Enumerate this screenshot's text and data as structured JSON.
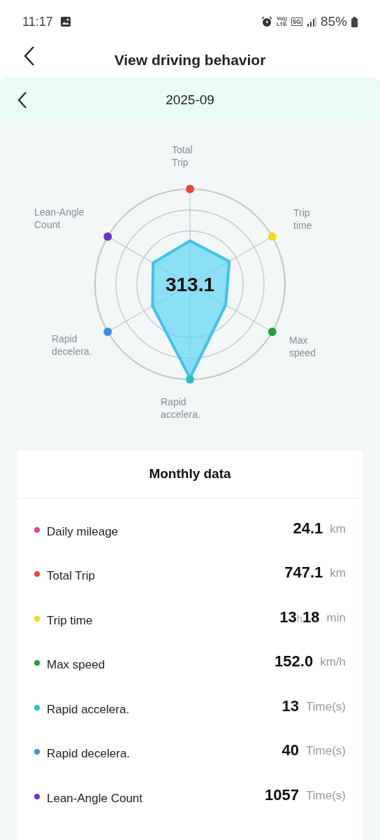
{
  "status_bar": {
    "time": "11:17",
    "volte": [
      "Vo))",
      "LTE"
    ],
    "network": "5G",
    "battery": "85%"
  },
  "header": {
    "title": "View driving behavior"
  },
  "month_bar": {
    "month": "2025-09"
  },
  "radar": {
    "score": "313.1",
    "axes": [
      {
        "label": [
          "Total",
          "Trip"
        ],
        "color": "#e8453c"
      },
      {
        "label": [
          "Lean-Angle",
          "Count"
        ],
        "color": "#6a35c8"
      },
      {
        "label": [
          "Trip",
          "time"
        ],
        "color": "#f5d916"
      },
      {
        "label": [
          "Rapid",
          "decelera."
        ],
        "color": "#3d8de8"
      },
      {
        "label": [
          "Max",
          "speed"
        ],
        "color": "#1aa33a"
      },
      {
        "label": [
          "Rapid",
          "accelera."
        ],
        "color": "#21c0c8"
      }
    ]
  },
  "monthly_data": {
    "title": "Monthly data",
    "rows": [
      {
        "kind": "number",
        "label": "Daily mileage",
        "color": "#e0409a",
        "value": "24.1",
        "unit": "km"
      },
      {
        "kind": "number",
        "label": "Total Trip",
        "color": "#e8453c",
        "value": "747.1",
        "unit": "km"
      },
      {
        "kind": "duration",
        "label": "Trip time",
        "color": "#f5d916",
        "value": "13",
        "hour_mark": "h",
        "minutes": "18",
        "unit": "min"
      },
      {
        "kind": "number",
        "label": "Max speed",
        "color": "#1aa33a",
        "value": "152.0",
        "unit": "km/h"
      },
      {
        "kind": "number",
        "label": "Rapid accelera.",
        "color": "#21c0c8",
        "value": "13",
        "unit": "Time(s)"
      },
      {
        "kind": "number",
        "label": "Rapid decelera.",
        "color": "#3d8de8",
        "value": "40",
        "unit": "Time(s)"
      },
      {
        "kind": "number",
        "label": "Lean-Angle Count",
        "color": "#6a35c8",
        "value": "1057",
        "unit": "Time(s)"
      }
    ]
  }
}
